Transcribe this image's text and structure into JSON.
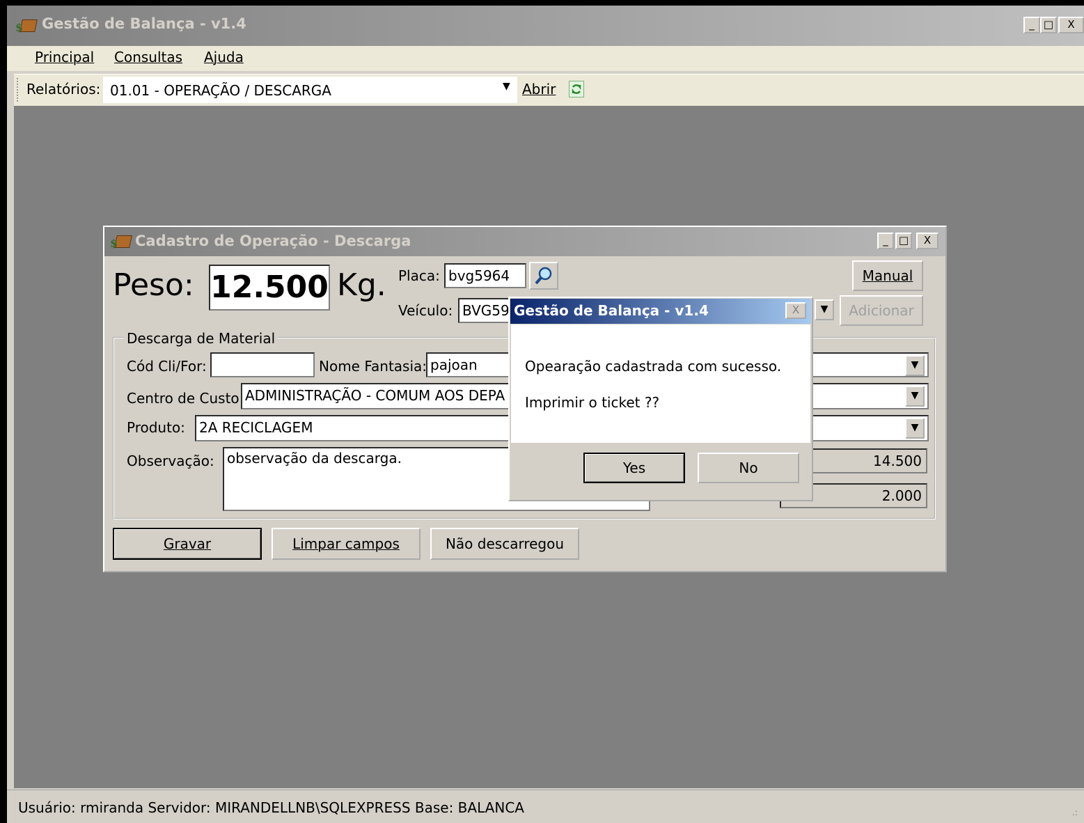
{
  "app": {
    "title": "Gestão de Balança - v1.4",
    "caption_buttons": [
      "_",
      "□",
      "X"
    ]
  },
  "menu": {
    "items": [
      {
        "label": "Principal"
      },
      {
        "label": "Consultas"
      },
      {
        "label": "Ajuda"
      }
    ]
  },
  "toolbar": {
    "reports_label": "Relatórios:",
    "report_selected": "01.01 - OPERAÇÃO / DESCARGA",
    "open_label": "Abrir",
    "refresh_icon": "refresh-icon"
  },
  "form": {
    "title": "Cadastro de Operação - Descarga",
    "peso_label": "Peso:",
    "peso_value": "12.500",
    "peso_unit": "Kg.",
    "placa_label": "Placa:",
    "placa_value": "bvg5964",
    "veiculo_label": "Veículo:",
    "veiculo_value": "BVG59",
    "manual_button": "Manual",
    "adicionar_button": "Adicionar",
    "group_label": "Descarga de Material",
    "cod_label": "Cód Cli/For:",
    "cod_value": "",
    "nome_fantasia_label": "Nome Fantasia:",
    "nome_fantasia_value": "pajoan",
    "centro_custo_label": "Centro de Custo:",
    "centro_custo_value": "ADMINISTRAÇÃO - COMUM AOS DEPA",
    "produto_label": "Produto:",
    "produto_value": "2A RECICLAGEM",
    "observacao_label": "Observação:",
    "observacao_value": "observação da descarga.",
    "value_1": "14.500",
    "value_2": "2.000",
    "gravar_button": "Gravar",
    "limpar_button": "Limpar campos",
    "nao_descarregou_button": "Não descarregou"
  },
  "dialog": {
    "title": "Gestão de Balança - v1.4",
    "message1": "Opearação cadastrada com sucesso.",
    "message2": "Imprimir o ticket ??",
    "yes_button": "Yes",
    "no_button": "No",
    "close": "X"
  },
  "status": {
    "text": "Usuário: rmiranda  Servidor: MIRANDELLNB\\SQLEXPRESS  Base: BALANCA"
  }
}
